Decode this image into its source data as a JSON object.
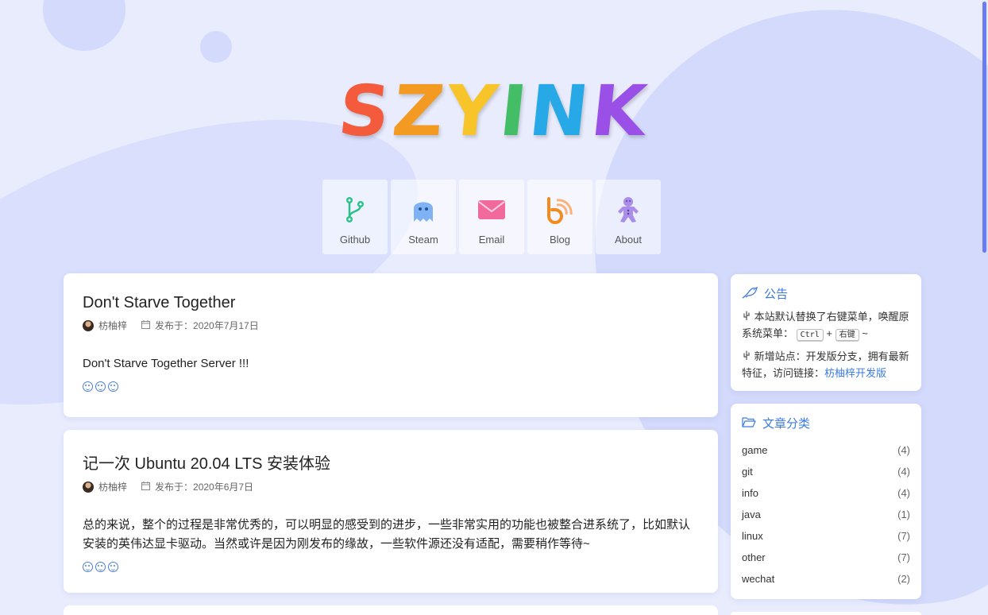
{
  "hero": {
    "letters": [
      {
        "ch": "S",
        "color": "#f45b3c"
      },
      {
        "ch": "Z",
        "color": "#f29a22"
      },
      {
        "ch": "Y",
        "color": "#f7c52a"
      },
      {
        "ch": "I",
        "color": "#43be67"
      },
      {
        "ch": "N",
        "color": "#27a9e8"
      },
      {
        "ch": "K",
        "color": "#9a4fe6"
      }
    ]
  },
  "nav": [
    {
      "label": "Github",
      "icon": "git-branch-icon"
    },
    {
      "label": "Steam",
      "icon": "ghost-icon"
    },
    {
      "label": "Email",
      "icon": "envelope-icon"
    },
    {
      "label": "Blog",
      "icon": "blogger-icon"
    },
    {
      "label": "About",
      "icon": "gingerbread-icon"
    }
  ],
  "posts": [
    {
      "title": "Don't Starve Together",
      "author": "枋柚梓",
      "date": "发布于：2020年7月17日",
      "excerpt": "Don't Starve Together Server !!!"
    },
    {
      "title": "记一次 Ubuntu 20.04 LTS 安装体验",
      "author": "枋柚梓",
      "date": "发布于：2020年6月7日",
      "excerpt": "总的来说，整个的过程是非常优秀的，可以明显的感受到的进步，一些非常实用的功能也被整合进系统了，比如默认安装的英伟达显卡驱动。当然或许是因为刚发布的缘故，一些软件源还没有适配，需要稍作等待~"
    }
  ],
  "notice": {
    "title": "公告",
    "line1_a": "本站默认替换了右键菜单，唤醒原系统菜单：",
    "key1": "Ctrl",
    "plus": "+",
    "key2": "右键",
    "tilde": "~",
    "line2_a": "新增站点：开发版分支，拥有最新特征，访问链接：",
    "line2_link": "枋柚梓开发版"
  },
  "categories": {
    "title": "文章分类",
    "items": [
      {
        "name": "game",
        "count": "(4)"
      },
      {
        "name": "git",
        "count": "(4)"
      },
      {
        "name": "info",
        "count": "(4)"
      },
      {
        "name": "java",
        "count": "(1)"
      },
      {
        "name": "linux",
        "count": "(7)"
      },
      {
        "name": "other",
        "count": "(7)"
      },
      {
        "name": "wechat",
        "count": "(2)"
      }
    ]
  },
  "colors": {
    "accent": "#3b7be0",
    "background": "#e9ecfd",
    "scrollbar": "#6b7bf0"
  }
}
